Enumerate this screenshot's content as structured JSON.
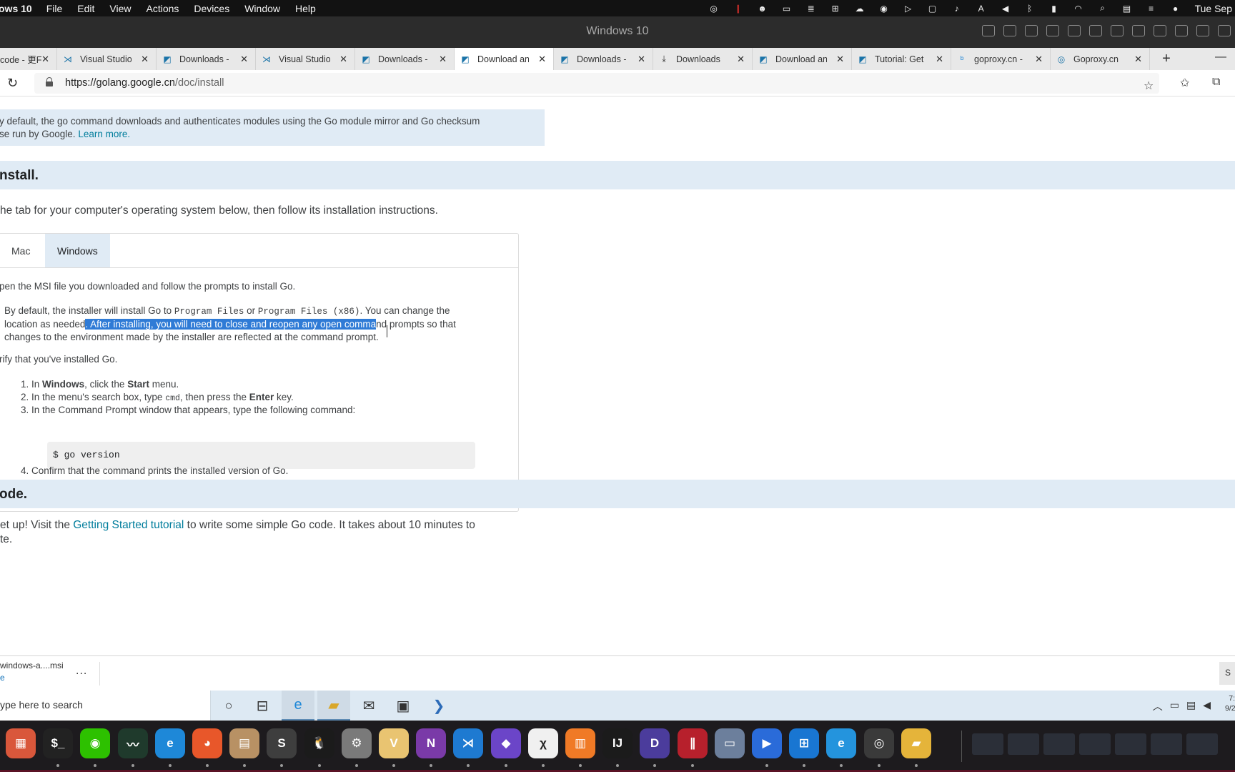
{
  "menubar": {
    "app": "ows 10",
    "menus": [
      "File",
      "Edit",
      "View",
      "Actions",
      "Devices",
      "Window",
      "Help"
    ],
    "clock": "Tue Sep"
  },
  "vm": {
    "title": "Windows 10"
  },
  "tabs": [
    {
      "label": "code - 更F",
      "icon": "file-icon"
    },
    {
      "label": "Visual Studio",
      "icon": "vscode-icon"
    },
    {
      "label": "Downloads -",
      "icon": "gopher-icon"
    },
    {
      "label": "Visual Studio",
      "icon": "vscode-icon"
    },
    {
      "label": "Downloads -",
      "icon": "gopher-icon"
    },
    {
      "label": "Download an",
      "icon": "gopher-icon",
      "active": true
    },
    {
      "label": "Downloads -",
      "icon": "gopher-icon"
    },
    {
      "label": "Downloads",
      "icon": "download-icon"
    },
    {
      "label": "Download an",
      "icon": "gopher-icon"
    },
    {
      "label": "Tutorial: Get",
      "icon": "gopher-icon"
    },
    {
      "label": "goproxy.cn -",
      "icon": "bing-icon"
    },
    {
      "label": "Goproxy.cn",
      "icon": "goproxy-icon"
    }
  ],
  "address": {
    "host": "https://golang.google.cn",
    "path": "/doc/install"
  },
  "page": {
    "proxy_line1": "y default, the go command downloads and authenticates modules using the Go module mirror and Go checksum",
    "proxy_line2": "se run by Google.",
    "learn_more": "Learn more.",
    "install_heading": "nstall.",
    "install_intro": "he tab for your computer's operating system below, then follow its installation instructions.",
    "os_tabs": [
      "Mac",
      "Windows"
    ],
    "open_msi": "pen the MSI file you downloaded and follow the prompts to install Go.",
    "note_a": "By default, the installer will install Go to ",
    "note_code1": "Program Files",
    "note_or": " or ",
    "note_code2": "Program Files (x86)",
    "note_b": ". You can change the",
    "note_c": "location as needed",
    "note_selected": ". After installing, you will need to close and reopen any open comma",
    "note_d": "nd prompts so that",
    "note_e": "changes to the environment made by the installer are reflected at the command prompt.",
    "verify": "rify that you've installed Go.",
    "step1_a": "1. In ",
    "step1_b": "Windows",
    "step1_c": ", click the ",
    "step1_d": "Start",
    "step1_e": " menu.",
    "step2_a": "2. In the menu's search box, type ",
    "step2_code": "cmd",
    "step2_b": ", then press the ",
    "step2_c": "Enter",
    "step2_d": " key.",
    "step3": "3. In the Command Prompt window that appears, type the following command:",
    "command": "$ go version",
    "step4": "4. Confirm that the command prints the installed version of Go.",
    "code_heading": "ode.",
    "code_a": "et up! Visit the ",
    "code_link": "Getting Started tutorial",
    "code_b": " to write some simple Go code. It takes about 10 minutes to",
    "code_c": "te."
  },
  "download": {
    "file": "windows-a....msi",
    "sub": "e",
    "more": "...",
    "show_all": "S"
  },
  "taskbar": {
    "search_placeholder": "ype here to search",
    "clock_line1": "7:",
    "clock_line2": "9/2"
  },
  "dock": [
    {
      "name": "launchpad",
      "color": "#d9573b",
      "glyph": "▦"
    },
    {
      "name": "terminal",
      "color": "#222222",
      "glyph": "$_"
    },
    {
      "name": "wechat",
      "color": "#2dc100",
      "glyph": "◉"
    },
    {
      "name": "activity-monitor",
      "color": "#1f3a2c",
      "glyph": "〰"
    },
    {
      "name": "edge",
      "color": "#1e88d8",
      "glyph": "e"
    },
    {
      "name": "firefox",
      "color": "#e8572a",
      "glyph": "◕"
    },
    {
      "name": "archive-utility",
      "color": "#b89164",
      "glyph": "▤"
    },
    {
      "name": "sublime-text",
      "color": "#3e3e3e",
      "glyph": "S"
    },
    {
      "name": "qq",
      "color": "#1b1b1b",
      "glyph": "🐧"
    },
    {
      "name": "system-preferences",
      "color": "#7a7a7a",
      "glyph": "⚙"
    },
    {
      "name": "vpn",
      "color": "#e9c471",
      "glyph": "V"
    },
    {
      "name": "onenote",
      "color": "#7a3aa8",
      "glyph": "N"
    },
    {
      "name": "vscode",
      "color": "#1e7ad1",
      "glyph": "⋊"
    },
    {
      "name": "obsidian",
      "color": "#6b45c8",
      "glyph": "◆"
    },
    {
      "name": "math-editor",
      "color": "#f0f0f0",
      "glyph": "χ"
    },
    {
      "name": "books",
      "color": "#f07a26",
      "glyph": "▥"
    },
    {
      "name": "intellij",
      "color": "#1b1b1b",
      "glyph": "IJ"
    },
    {
      "name": "deepl",
      "color": "#4b3c9c",
      "glyph": "D"
    },
    {
      "name": "parallels",
      "color": "#b7202c",
      "glyph": "∥"
    },
    {
      "name": "vm-screenshot",
      "color": "#6c7f9c",
      "glyph": "▭"
    },
    {
      "name": "player",
      "color": "#2a6bd9",
      "glyph": "▶"
    },
    {
      "name": "windows",
      "color": "#1976d2",
      "glyph": "⊞"
    },
    {
      "name": "edge-vm",
      "color": "#2494dd",
      "glyph": "e"
    },
    {
      "name": "obs",
      "color": "#3a3a3a",
      "glyph": "◎"
    },
    {
      "name": "file-explorer",
      "color": "#e5b43a",
      "glyph": "▰"
    }
  ]
}
